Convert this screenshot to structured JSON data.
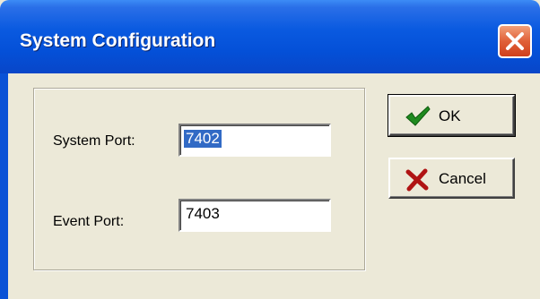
{
  "window": {
    "title": "System Configuration"
  },
  "icons": {
    "close": "close-icon",
    "ok": "checkmark-icon",
    "cancel": "x-icon"
  },
  "fields": {
    "system_port": {
      "label": "System Port:",
      "value": "7402"
    },
    "event_port": {
      "label": "Event Port:",
      "value": "7403"
    }
  },
  "buttons": {
    "ok_label": "OK",
    "cancel_label": "Cancel"
  },
  "colors": {
    "titlebar": "#0a5ae0",
    "selection": "#316ac5",
    "close_button": "#e06038"
  }
}
